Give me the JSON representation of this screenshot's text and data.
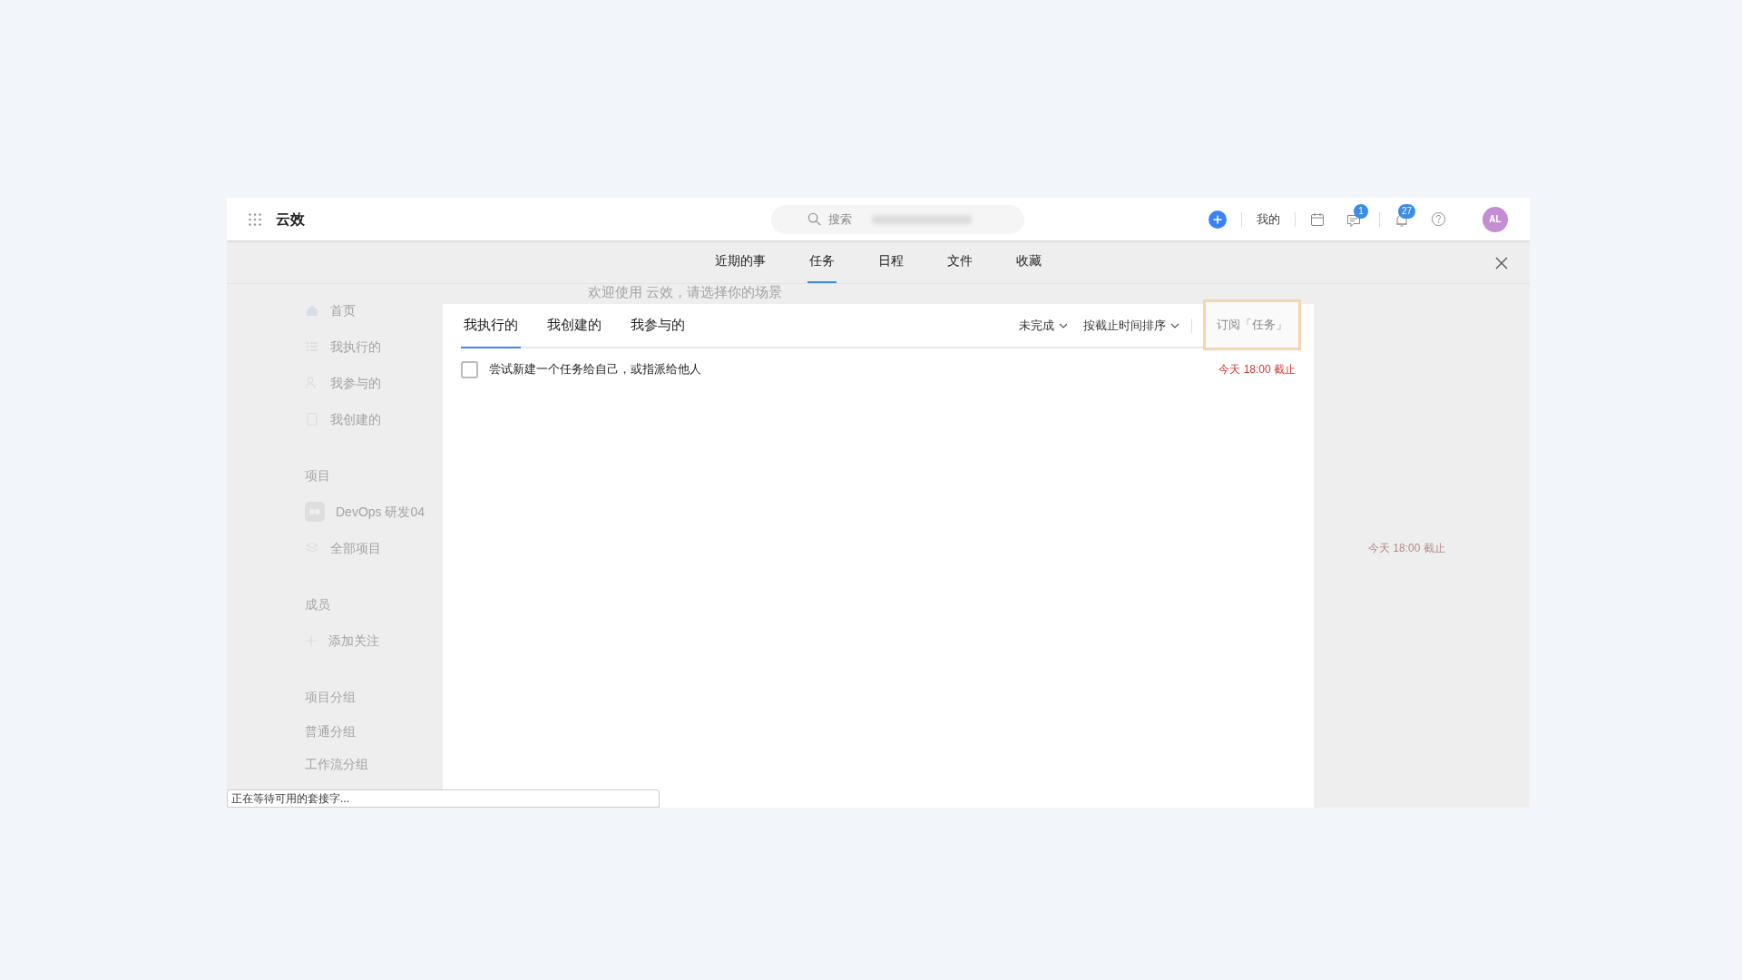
{
  "header": {
    "logo": "云效",
    "search": {
      "placeholder": "搜索"
    },
    "my_link": "我的",
    "message_badge": "1",
    "notification_badge": "27",
    "avatar": "AL"
  },
  "nav_tabs": [
    {
      "label": "近期的事",
      "selected": false
    },
    {
      "label": "任务",
      "selected": true
    },
    {
      "label": "日程",
      "selected": false
    },
    {
      "label": "文件",
      "selected": false
    },
    {
      "label": "收藏",
      "selected": false
    }
  ],
  "background": {
    "welcome": "欢迎使用 云效，请选择你的场景",
    "sidebar": [
      {
        "label": "首页",
        "kind": "home"
      },
      {
        "label": "我执行的",
        "kind": "list"
      },
      {
        "label": "我参与的",
        "kind": "people"
      },
      {
        "label": "我创建的",
        "kind": "doc"
      },
      {
        "label": "项目",
        "kind": "heading"
      },
      {
        "label": "DevOps 研发04",
        "kind": "project"
      },
      {
        "label": "全部项目",
        "kind": "layers"
      },
      {
        "label": "成员",
        "kind": "heading"
      },
      {
        "label": "添加关注",
        "kind": "add"
      },
      {
        "label": "项目分组",
        "kind": "heading"
      },
      {
        "label": "普通分组",
        "kind": "plain"
      },
      {
        "label": "工作流分组",
        "kind": "plain"
      }
    ],
    "deadline": "今天 18:00 截止"
  },
  "panel": {
    "tabs": [
      {
        "label": "我执行的",
        "selected": true
      },
      {
        "label": "我创建的",
        "selected": false
      },
      {
        "label": "我参与的",
        "selected": false
      }
    ],
    "filter": "未完成",
    "sort": "按截止时间排序",
    "subscribe": "订阅「任务」",
    "tasks": [
      {
        "title": "尝试新建一个任务给自己，或指派给他人",
        "checked": false,
        "deadline": "今天 18:00 截止"
      }
    ]
  },
  "status_bar": "正在等待可用的套接字..."
}
